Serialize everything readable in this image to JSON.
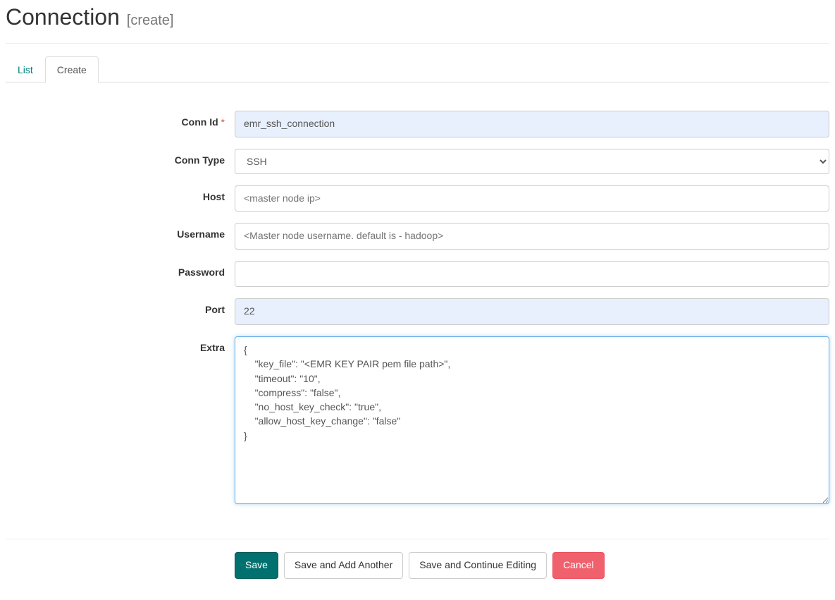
{
  "header": {
    "title": "Connection",
    "subtitle": "[create]"
  },
  "tabs": {
    "list": "List",
    "create": "Create"
  },
  "form": {
    "conn_id": {
      "label": "Conn Id",
      "value": "emr_ssh_connection"
    },
    "conn_type": {
      "label": "Conn Type",
      "value": "SSH"
    },
    "host": {
      "label": "Host",
      "placeholder": "<master node ip>"
    },
    "username": {
      "label": "Username",
      "placeholder": "<Master node username. default is - hadoop>"
    },
    "password": {
      "label": "Password",
      "value": ""
    },
    "port": {
      "label": "Port",
      "value": "22"
    },
    "extra": {
      "label": "Extra",
      "value": "{\n    \"key_file\": \"<EMR KEY PAIR pem file path>\",\n    \"timeout\": \"10\",\n    \"compress\": \"false\",\n    \"no_host_key_check\": \"true\",\n    \"allow_host_key_change\": \"false\"\n}"
    }
  },
  "buttons": {
    "save": "Save",
    "save_add": "Save and Add Another",
    "save_continue": "Save and Continue Editing",
    "cancel": "Cancel"
  }
}
